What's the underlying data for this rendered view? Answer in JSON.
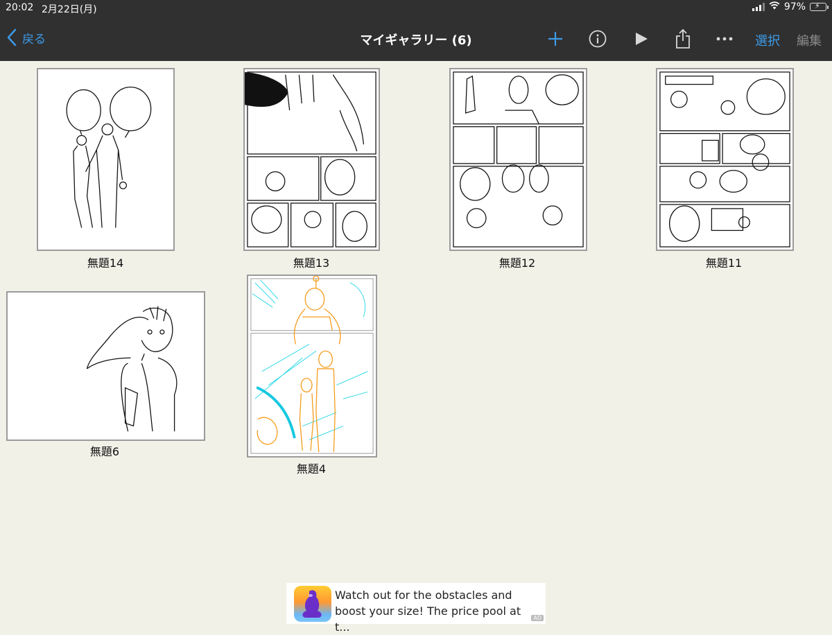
{
  "status_bar": {
    "time": "20:02",
    "date": "2月22日(月)",
    "battery_text": "97%",
    "battery_level": 0.97
  },
  "nav": {
    "back_label": "戻る",
    "title": "マイギャラリー (6)",
    "select_label": "選択",
    "edit_label": "編集",
    "accent_color": "#3d9be9"
  },
  "gallery": {
    "items": [
      {
        "title": "無題14"
      },
      {
        "title": "無題13"
      },
      {
        "title": "無題12"
      },
      {
        "title": "無題11"
      },
      {
        "title": "無題6"
      },
      {
        "title": "無題4"
      }
    ]
  },
  "ad": {
    "text_line1": "Watch out for the obstacles and",
    "text_line2": "boost your size! The price pool at t...",
    "badge": "AD"
  }
}
